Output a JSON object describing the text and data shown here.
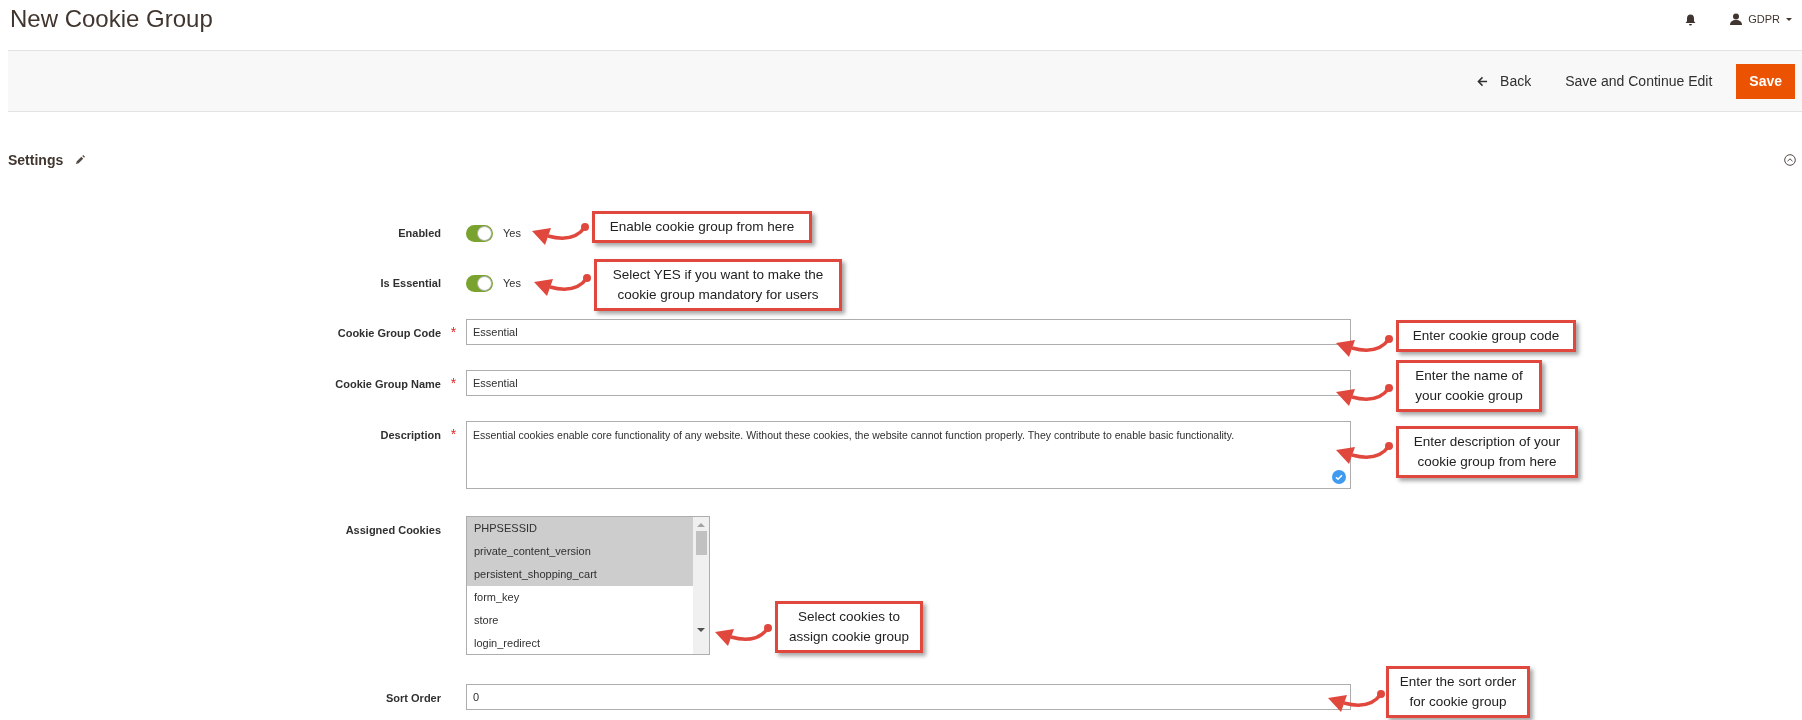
{
  "header": {
    "title": "New Cookie Group",
    "user": "GDPR"
  },
  "actions": [
    {
      "kind": "back",
      "label": "Back"
    },
    {
      "kind": "link",
      "label": "Save and Continue Edit"
    },
    {
      "kind": "primary",
      "label": "Save"
    }
  ],
  "section": {
    "title": "Settings",
    "expanded": true
  },
  "fields": [
    {
      "kind": "toggle",
      "label": "Enabled",
      "on": true,
      "value": "Yes"
    },
    {
      "kind": "toggle",
      "label": "Is Essential",
      "on": true,
      "value": "Yes"
    },
    {
      "kind": "text",
      "label": "Cookie Group Code",
      "required_mark": "*",
      "value": "Essential"
    },
    {
      "kind": "text",
      "label": "Cookie Group Name",
      "required_mark": "*",
      "value": "Essential"
    },
    {
      "kind": "textarea",
      "label": "Description",
      "required_mark": "*",
      "value": "Essential cookies enable core functionality of any website. Without these cookies, the website cannot function properly. They contribute to enable basic functionality."
    },
    {
      "kind": "multiselect",
      "label": "Assigned Cookies",
      "options": [
        {
          "label": "PHPSESSID",
          "selected": true
        },
        {
          "label": "private_content_version",
          "selected": true
        },
        {
          "label": "persistent_shopping_cart",
          "selected": true
        },
        {
          "label": "form_key",
          "selected": false
        },
        {
          "label": "store",
          "selected": false
        },
        {
          "label": "login_redirect",
          "selected": false
        }
      ]
    },
    {
      "kind": "text",
      "label": "Sort Order",
      "value": "0"
    }
  ],
  "callouts": [
    {
      "lines": [
        "Enable cookie group from here"
      ]
    },
    {
      "lines": [
        "Select YES if you want to make the",
        "cookie group mandatory for users"
      ]
    },
    {
      "lines": [
        "Enter cookie group code"
      ]
    },
    {
      "lines": [
        "Enter the name of",
        "your cookie group"
      ]
    },
    {
      "lines": [
        "Enter description of your",
        "cookie group from here"
      ]
    },
    {
      "lines": [
        "Select cookies to",
        "assign cookie group"
      ]
    },
    {
      "lines": [
        "Enter the sort order",
        "for cookie group"
      ]
    }
  ]
}
